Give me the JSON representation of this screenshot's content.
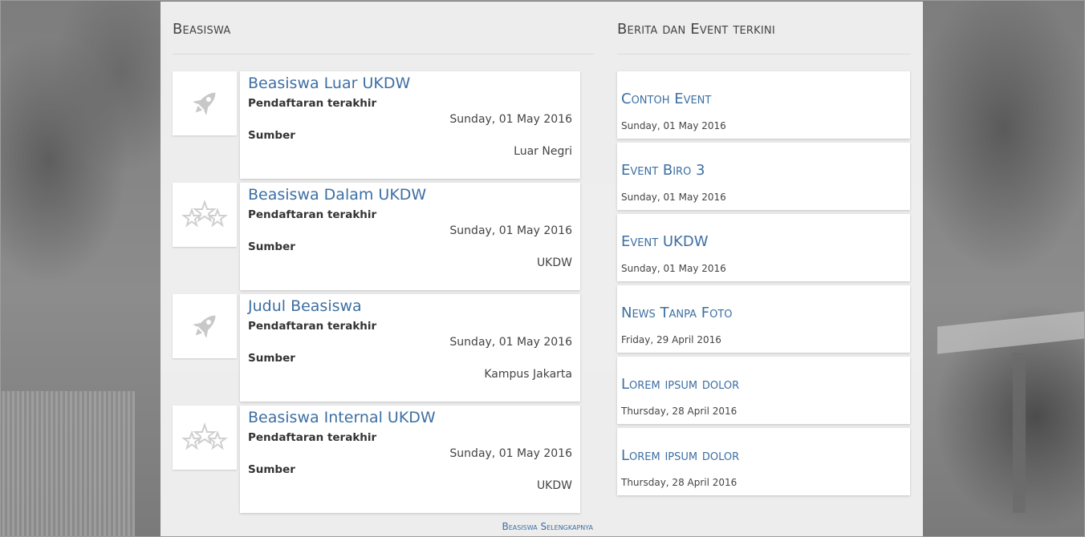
{
  "scholarship_section": {
    "title": "Beasiswa",
    "items": [
      {
        "title": "Beasiswa Luar UKDW",
        "label_deadline": "Pendaftaran terakhir",
        "date": "Sunday, 01 May 2016",
        "label_source": "Sumber",
        "source": "Luar Negri",
        "icon": "rocket-icon"
      },
      {
        "title": "Beasiswa Dalam UKDW",
        "label_deadline": "Pendaftaran terakhir",
        "date": "Sunday, 01 May 2016",
        "label_source": "Sumber",
        "source": "UKDW",
        "icon": "stars-icon"
      },
      {
        "title": "Judul Beasiswa",
        "label_deadline": "Pendaftaran terakhir",
        "date": "Sunday, 01 May 2016",
        "label_source": "Sumber",
        "source": "Kampus Jakarta",
        "icon": "rocket-icon"
      },
      {
        "title": "Beasiswa Internal UKDW",
        "label_deadline": "Pendaftaran terakhir",
        "date": "Sunday, 01 May 2016",
        "label_source": "Sumber",
        "source": "UKDW",
        "icon": "stars-icon"
      }
    ],
    "more_link": "Beasiswa Selengkapnya"
  },
  "news_section": {
    "title": "Berita dan Event terkini",
    "items": [
      {
        "title": "Contoh Event",
        "date": "Sunday, 01 May 2016"
      },
      {
        "title": "Event Biro 3",
        "date": "Sunday, 01 May 2016"
      },
      {
        "title": "Event UKDW",
        "date": "Sunday, 01 May 2016"
      },
      {
        "title": "News Tanpa Foto",
        "date": "Friday, 29 April 2016"
      },
      {
        "title": "Lorem ipsum dolor",
        "date": "Thursday, 28 April 2016"
      },
      {
        "title": "Lorem ipsum dolor",
        "date": "Thursday, 28 April 2016"
      }
    ]
  },
  "colors": {
    "link": "#3d6fa3",
    "panel": "#f5f5f5",
    "icon": "#c8c8c8"
  }
}
